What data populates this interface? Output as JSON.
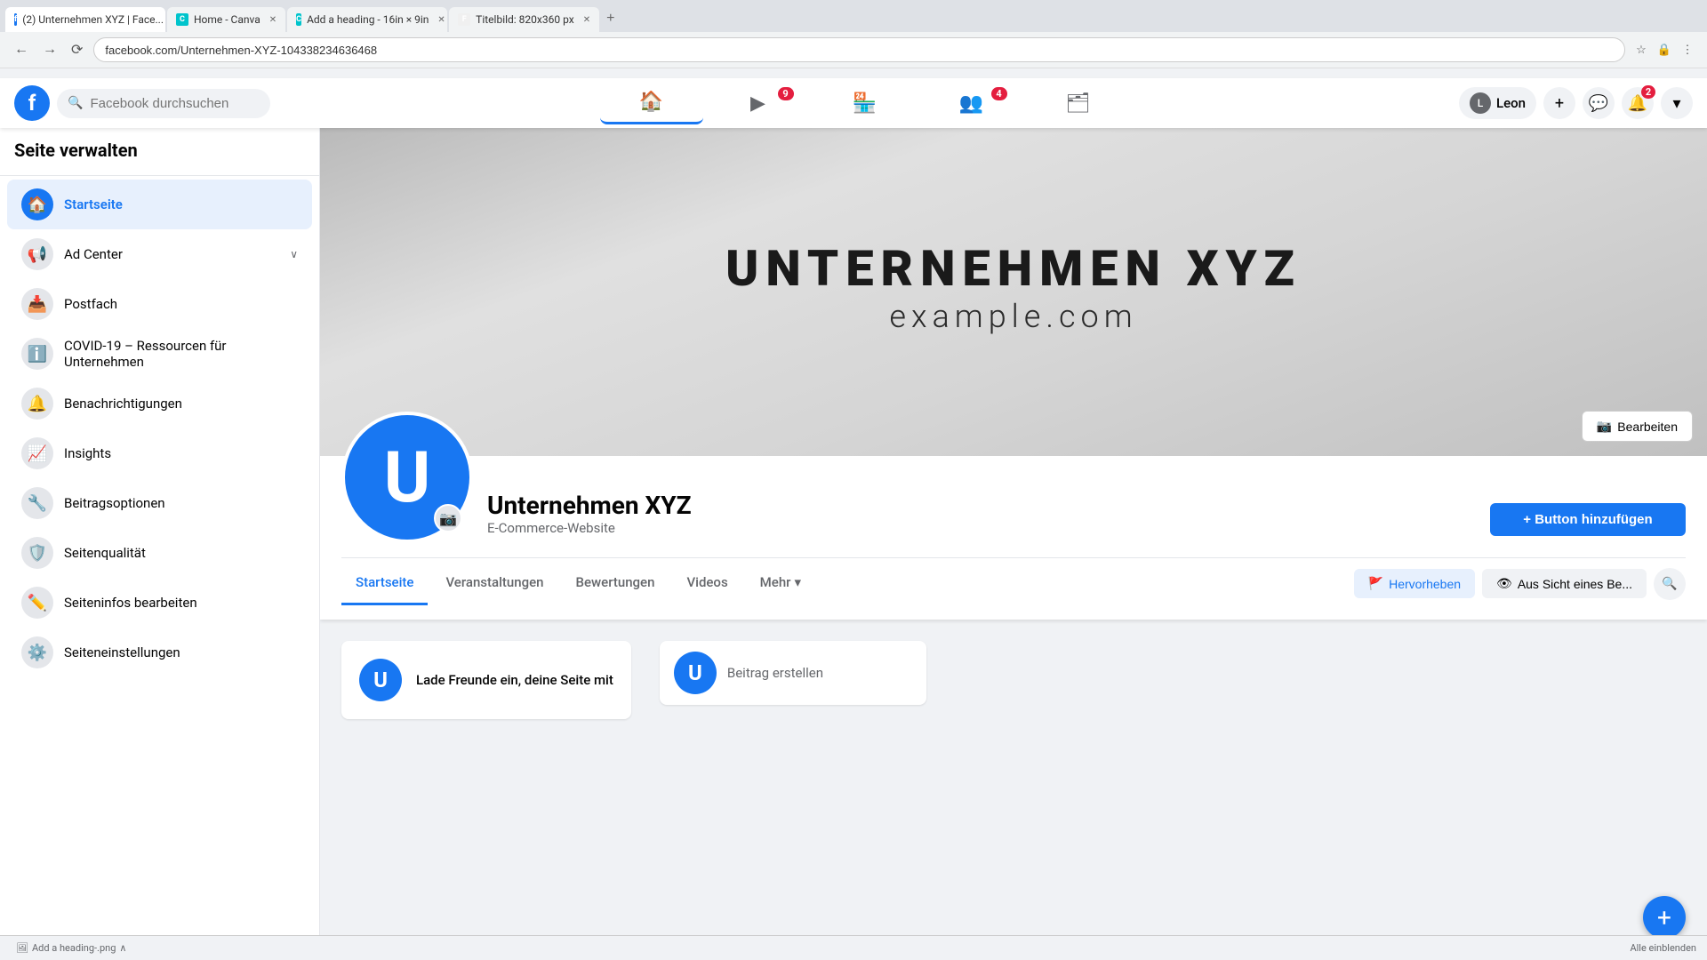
{
  "browser": {
    "tabs": [
      {
        "label": "(2) Unternehmen XYZ | Face...",
        "favicon_bg": "#1877f2",
        "favicon_text": "f",
        "active": true
      },
      {
        "label": "Home - Canva",
        "favicon_bg": "#00c4cc",
        "favicon_text": "C",
        "active": false
      },
      {
        "label": "Add a heading - 16in × 9in",
        "favicon_bg": "#00c4cc",
        "favicon_text": "C",
        "active": false
      },
      {
        "label": "Titelbild: 820x360 px",
        "favicon_bg": "#f0f0f0",
        "favicon_text": "F",
        "active": false
      }
    ],
    "url": "facebook.com/Unternehmen-XYZ-104338234636468"
  },
  "navbar": {
    "search_placeholder": "Facebook durchsuchen",
    "user_name": "Leon",
    "notifications_badge": "2",
    "groups_badge": "4",
    "watch_badge": "9"
  },
  "sidebar": {
    "title": "Seite verwalten",
    "items": [
      {
        "id": "startseite",
        "label": "Startseite",
        "icon": "🏠",
        "active": true,
        "has_chevron": false
      },
      {
        "id": "ad-center",
        "label": "Ad Center",
        "icon": "📢",
        "active": false,
        "has_chevron": true
      },
      {
        "id": "postfach",
        "label": "Postfach",
        "icon": "📥",
        "active": false,
        "has_chevron": false
      },
      {
        "id": "covid",
        "label": "COVID-19 – Ressourcen für Unternehmen",
        "icon": "ℹ️",
        "active": false,
        "has_chevron": false
      },
      {
        "id": "benachrichtigungen",
        "label": "Benachrichtigungen",
        "icon": "🔔",
        "active": false,
        "has_chevron": false
      },
      {
        "id": "insights",
        "label": "Insights",
        "icon": "📈",
        "active": false,
        "has_chevron": false
      },
      {
        "id": "beitragsoptionen",
        "label": "Beitragsoptionen",
        "icon": "🔧",
        "active": false,
        "has_chevron": false
      },
      {
        "id": "seitenqualitaet",
        "label": "Seitenqualität",
        "icon": "🛡️",
        "active": false,
        "has_chevron": false
      },
      {
        "id": "seiteninfos",
        "label": "Seiteninfos bearbeiten",
        "icon": "✏️",
        "active": false,
        "has_chevron": false
      },
      {
        "id": "seiteneinstellungen",
        "label": "Seiteneinstellungen",
        "icon": "⚙️",
        "active": false,
        "has_chevron": false
      }
    ]
  },
  "cover": {
    "company_name": "UNTERNEHMEN XYZ",
    "website": "example.com",
    "edit_button": "Bearbeiten"
  },
  "profile": {
    "name": "Unternehmen XYZ",
    "category": "E-Commerce-Website",
    "avatar_letter": "U",
    "add_button_label": "+ Button hinzufügen",
    "tabs": [
      {
        "label": "Startseite",
        "active": true
      },
      {
        "label": "Veranstaltungen",
        "active": false
      },
      {
        "label": "Bewertungen",
        "active": false
      },
      {
        "label": "Videos",
        "active": false
      },
      {
        "label": "Mehr",
        "active": false
      }
    ],
    "tab_actions": {
      "hervorheben": "Hervorheben",
      "aus_sicht": "Aus Sicht eines Be..."
    }
  },
  "content": {
    "invite_text": "Lade Freunde ein, deine Seite mit",
    "create_post_label": "Beitrag erstellen"
  },
  "taskbar": {
    "item_label": "Add a heading-.png",
    "expand_label": "Alle einblenden"
  }
}
